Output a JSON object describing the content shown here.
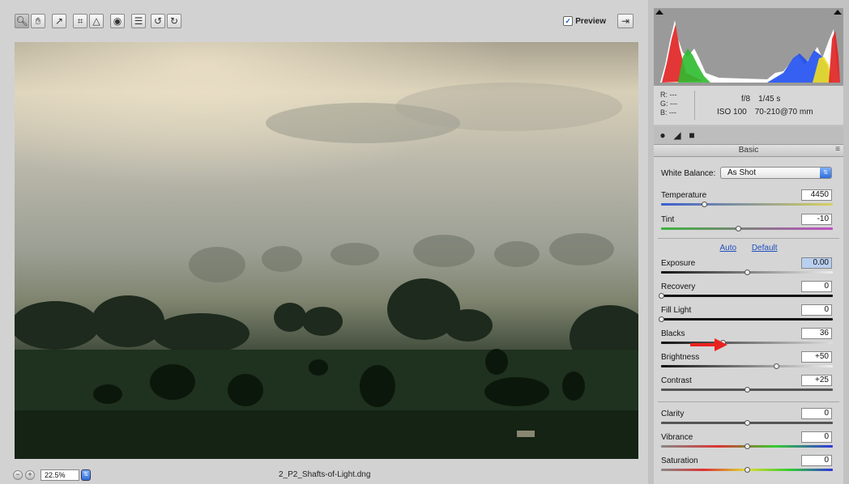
{
  "toolbar": {
    "tools": [
      "zoom-tool",
      "hand-tool",
      "white-balance-tool",
      "crop-tool",
      "straighten-tool",
      "red-eye-tool",
      "preferences",
      "rotate-left",
      "rotate-right"
    ],
    "preview_label": "Preview",
    "preview_checked": true
  },
  "statusbar": {
    "zoom": "22.5%",
    "filename": "2_P2_Shafts-of-Light.dng"
  },
  "histogram": {
    "colors": {
      "red": "#e02020",
      "green": "#2dbb2d",
      "blue": "#1f4ff0",
      "yellow": "#f0e020",
      "white": "#ffffff"
    }
  },
  "info": {
    "r": "R:  ---",
    "g": "G:  ---",
    "b": "B:  ---",
    "aperture": "f/8",
    "shutter": "1/45 s",
    "iso": "ISO 100",
    "lens": "70-210@70 mm"
  },
  "panel": {
    "title": "Basic",
    "white_balance_label": "White Balance:",
    "white_balance_value": "As Shot",
    "auto_label": "Auto",
    "default_label": "Default",
    "sliders": [
      {
        "label": "Temperature",
        "value": "4450",
        "level": 0.25
      },
      {
        "label": "Tint",
        "value": "-10",
        "level": 0.45
      },
      {
        "label": "Exposure",
        "value": "0.00",
        "level": 0.5,
        "selected": true
      },
      {
        "label": "Recovery",
        "value": "0",
        "level": 0.0
      },
      {
        "label": "Fill Light",
        "value": "0",
        "level": 0.0
      },
      {
        "label": "Blacks",
        "value": "36",
        "level": 0.36
      },
      {
        "label": "Brightness",
        "value": "+50",
        "level": 0.67
      },
      {
        "label": "Contrast",
        "value": "+25",
        "level": 0.5
      },
      {
        "label": "Clarity",
        "value": "0",
        "level": 0.5
      },
      {
        "label": "Vibrance",
        "value": "0",
        "level": 0.5
      },
      {
        "label": "Saturation",
        "value": "0",
        "level": 0.5
      }
    ]
  },
  "colors": {
    "arrow": "#e8231f",
    "link": "#1f4fbf"
  }
}
